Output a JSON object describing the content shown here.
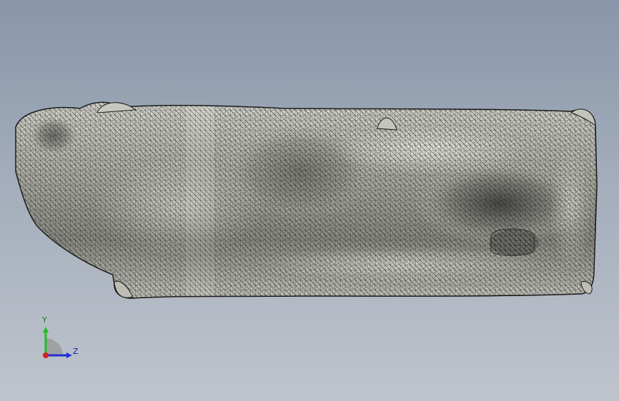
{
  "viewport": {
    "background_top": "#8996a9",
    "background_bottom": "#bfc4cc",
    "model": "meshed-part",
    "mesh_color": "#2a2a28",
    "surface_color": "#9a9a94"
  },
  "triad": {
    "y_label": "Y",
    "z_label": "Z",
    "y_color": "#1fbf1f",
    "z_color": "#1f2fd8",
    "x_color": "#d81f1f"
  }
}
